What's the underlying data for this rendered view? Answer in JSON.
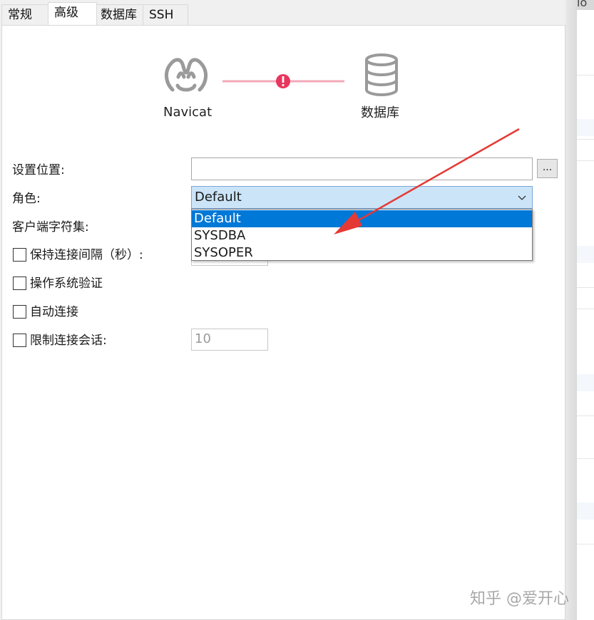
{
  "tabs": [
    "常规",
    "高级",
    "数据库",
    "SSH"
  ],
  "active_tab": "高级",
  "diagram": {
    "left_label": "Navicat",
    "right_label": "数据库",
    "left_icon": "navicat-logo-icon",
    "right_icon": "database-icon",
    "status_icon": "warning-icon",
    "status_color": "#e8365d",
    "line_color": "#f2a9ba"
  },
  "form": {
    "settings_location_label": "设置位置:",
    "settings_location_value": "",
    "browse_label": "...",
    "role_label": "角色:",
    "role_selected": "Default",
    "role_options": [
      "Default",
      "SYSDBA",
      "SYSOPER"
    ],
    "charset_label": "客户端字符集:",
    "keepalive_label": "保持连接间隔（秒）:",
    "os_auth_label": "操作系统验证",
    "auto_connect_label": "自动连接",
    "limit_sessions_label": "限制连接会话:",
    "limit_sessions_value": "10"
  },
  "background": {
    "top_text": "io"
  },
  "watermark": "知乎 @爱开心",
  "colors": {
    "accent": "#0078d7",
    "combo_bg": "#cce4f7",
    "annotation_arrow": "#e53935"
  }
}
